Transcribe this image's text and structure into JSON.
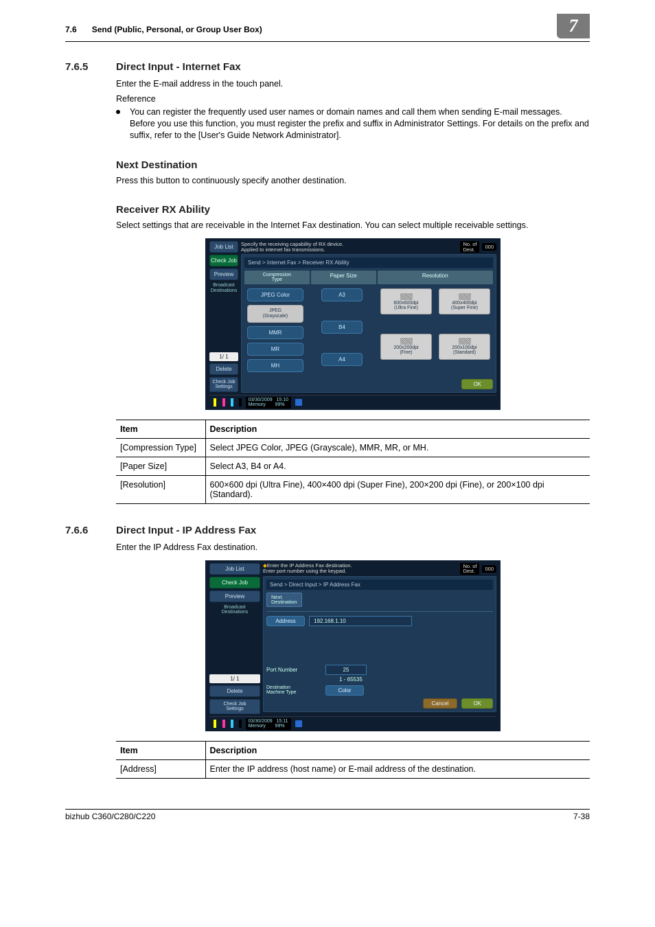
{
  "header": {
    "secnum": "7.6",
    "sectitle": "Send (Public, Personal, or Group User Box)",
    "chapter": "7"
  },
  "s765": {
    "num": "7.6.5",
    "title": "Direct Input - Internet Fax",
    "intro": "Enter the E-mail address in the touch panel.",
    "reference_label": "Reference",
    "bullet": "You can register the frequently used user names or domain names and call them when sending E-mail messages. Before you use this function, you must register the prefix and suffix in Administrator Settings. For details on the prefix and suffix, refer to the [User's Guide Network Administrator]."
  },
  "nextdest": {
    "title": "Next Destination",
    "para": "Press this button to continuously specify another destination."
  },
  "rxability": {
    "title": "Receiver RX Ability",
    "para": "Select settings that are receivable in the Internet Fax destination. You can select multiple receivable settings."
  },
  "device1": {
    "side": {
      "joblist": "Job List",
      "checkjob": "Check Job",
      "preview": "Preview",
      "broadcast": "Broadcast\nDestinations",
      "pager": "1/   1",
      "delete": "Delete",
      "checkjob_settings": "Check Job\nSettings"
    },
    "top": {
      "message": "Specify the receiving capability of RX device.\nApplied to internet fax transmissions.",
      "badge1": "No. of\nDest.",
      "badge2": "000"
    },
    "crumb": "Send > Internet Fax > Receiver RX Ability",
    "tabs": {
      "compression": "Compression\nType",
      "paper": "Paper Size",
      "resolution": "Resolution"
    },
    "compression_buttons": [
      "JPEG Color",
      "JPEG\n(Grayscale)",
      "MMR",
      "MR",
      "MH"
    ],
    "paper_buttons": [
      "A3",
      "B4",
      "A4"
    ],
    "res_buttons": [
      {
        "label": "600x600dpi\n(Ultra Fine)"
      },
      {
        "label": "400x400dpi\n(Super Fine)"
      },
      {
        "label": "200x200dpi\n(Fine)"
      },
      {
        "label": "200x100dpi\n(Standard)"
      }
    ],
    "ok": "OK",
    "status": {
      "date": "03/30/2009",
      "time": "15:10",
      "mem_label": "Memory",
      "mem": "99%"
    }
  },
  "table1": {
    "headers": [
      "Item",
      "Description"
    ],
    "rows": [
      [
        "[Compression Type]",
        "Select JPEG Color, JPEG (Grayscale), MMR, MR, or MH."
      ],
      [
        "[Paper Size]",
        "Select A3, B4 or A4."
      ],
      [
        "[Resolution]",
        "600×600 dpi (Ultra Fine), 400×400 dpi (Super Fine), 200×200 dpi (Fine), or 200×100 dpi (Standard)."
      ]
    ]
  },
  "s766": {
    "num": "7.6.6",
    "title": "Direct Input - IP Address Fax",
    "intro": "Enter the IP Address Fax destination."
  },
  "device2": {
    "top": {
      "message": "Enter the IP Address Fax destination.\nEnter port number using the keypad.",
      "badge1": "No. of\nDest.",
      "badge2": "000"
    },
    "crumb": "Send > Direct Input > IP Address Fax",
    "nextdest": "Next\nDestination",
    "address_label": "Address",
    "address_value": "192.168.1.10",
    "port_label": "Port Number",
    "port_value": "25",
    "port_range": "1   -   65535",
    "machine_label": "Destination\nMachine Type",
    "machine_value": "Color",
    "cancel": "Cancel",
    "ok": "OK",
    "status": {
      "date": "03/30/2009",
      "time": "15:11",
      "mem_label": "Memory",
      "mem": "99%"
    }
  },
  "table2": {
    "headers": [
      "Item",
      "Description"
    ],
    "rows": [
      [
        "[Address]",
        "Enter the IP address (host name) or E-mail address of the destination."
      ]
    ]
  },
  "footer": {
    "left": "bizhub C360/C280/C220",
    "right": "7-38"
  }
}
